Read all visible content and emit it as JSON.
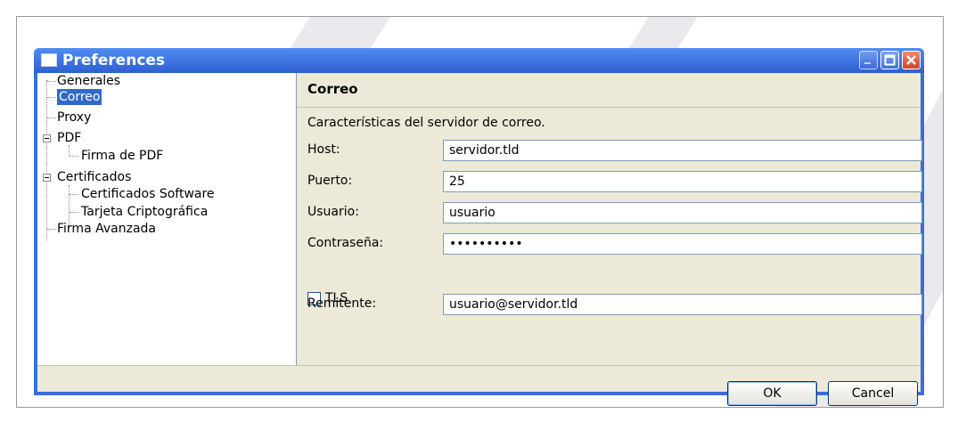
{
  "window": {
    "title": "Preferences",
    "title_bar_color": "#2f5fd0",
    "icons": [
      "window-icon",
      "minimize-icon",
      "maximize-icon",
      "close-icon"
    ]
  },
  "tree": {
    "items": [
      {
        "label": "Generales"
      },
      {
        "label": "Correo",
        "selected": true
      },
      {
        "label": "Proxy"
      },
      {
        "label": "PDF",
        "expanded": true
      },
      {
        "label": "Firma de PDF"
      },
      {
        "label": "Certificados",
        "expanded": true
      },
      {
        "label": "Certificados Software"
      },
      {
        "label": "Tarjeta Criptográfica"
      },
      {
        "label": "Firma Avanzada"
      }
    ]
  },
  "panel": {
    "title": "Correo",
    "description": "Características del servidor de correo.",
    "host_label": "Host:",
    "host_value": "servidor.tld",
    "port_label": "Puerto:",
    "port_value": "25",
    "user_label": "Usuario:",
    "user_value": "usuario",
    "password_label": "Contraseña:",
    "password_value": "usuario123",
    "tls_label": "TLS",
    "tls_checked": false,
    "sender_label": "Remitente:",
    "sender_value": "usuario@servidor.tld"
  },
  "buttons": {
    "ok": "OK",
    "cancel": "Cancel"
  },
  "colors": {
    "selection": "#316ac5",
    "dialog_background": "#ece9d8",
    "close_button": "#d2452a"
  }
}
